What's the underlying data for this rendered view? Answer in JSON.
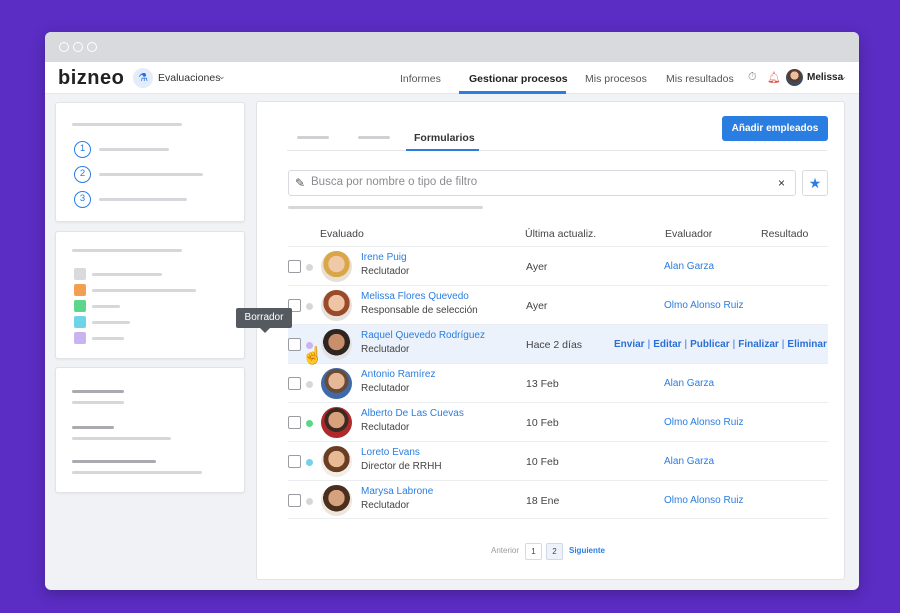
{
  "brand": {
    "logo": "bizneo"
  },
  "module": {
    "label": "Evaluaciones",
    "icon": "flask-icon"
  },
  "nav": {
    "items": [
      {
        "label": "Informes",
        "active": false
      },
      {
        "label": "Gestionar procesos",
        "active": true
      },
      {
        "label": "Mis procesos",
        "active": false
      },
      {
        "label": "Mis resultados",
        "active": false
      }
    ],
    "icons": [
      "timer-icon",
      "bell-icon"
    ],
    "user": "Melissa"
  },
  "sidebar": {
    "steps": [
      "1",
      "2",
      "3"
    ],
    "colors": [
      "#d9dadd",
      "#f0a050",
      "#5dd68a",
      "#6fd3e9",
      "#c9b3f0"
    ]
  },
  "tabs": {
    "active": "Formularios"
  },
  "toolbar": {
    "add_button": "Añadir empleados"
  },
  "search": {
    "placeholder": "Busca por nombre o tipo de filtro",
    "clear": "×",
    "star": "★"
  },
  "table": {
    "headers": {
      "evaluado": "Evaluado",
      "updated": "Última actualiz.",
      "evaluador": "Evaluador",
      "resultado": "Resultado"
    },
    "rows": [
      {
        "name": "Irene Puig",
        "role": "Reclutador",
        "updated": "Ayer",
        "evaluator": "Alan Garza",
        "status_color": "#d6d7da"
      },
      {
        "name": "Melissa Flores Quevedo",
        "role": "Responsable de selección",
        "updated": "Ayer",
        "evaluator": "Olmo Alonso Ruiz",
        "status_color": "#d6d7da"
      },
      {
        "name": "Raquel Quevedo Rodríguez",
        "role": "Reclutador",
        "updated": "Hace 2 días",
        "evaluator": "",
        "status_color": "#c9b3f0"
      },
      {
        "name": "Antonio Ramírez",
        "role": "Reclutador",
        "updated": "13 Feb",
        "evaluator": "Alan Garza",
        "status_color": "#d6d7da"
      },
      {
        "name": "Alberto De Las Cuevas",
        "role": "Reclutador",
        "updated": "10 Feb",
        "evaluator": "Olmo Alonso Ruiz",
        "status_color": "#5dd68a"
      },
      {
        "name": "Loreto Evans",
        "role": "Director de RRHH",
        "updated": "10 Feb",
        "evaluator": "Alan Garza",
        "status_color": "#6fd3e9"
      },
      {
        "name": "Marysa Labrone",
        "role": "Reclutador",
        "updated": "18 Ene",
        "evaluator": "Olmo Alonso Ruiz",
        "status_color": "#d6d7da"
      }
    ],
    "row_actions": {
      "send": "Enviar",
      "edit": "Editar",
      "publish": "Publicar",
      "finish": "Finalizar",
      "delete": "Eliminar",
      "sep": "|"
    },
    "tooltip": "Borrador"
  },
  "pagination": {
    "prev": "Anterior",
    "pages": [
      "1",
      "2"
    ],
    "current": "2",
    "next": "Siguiente"
  }
}
